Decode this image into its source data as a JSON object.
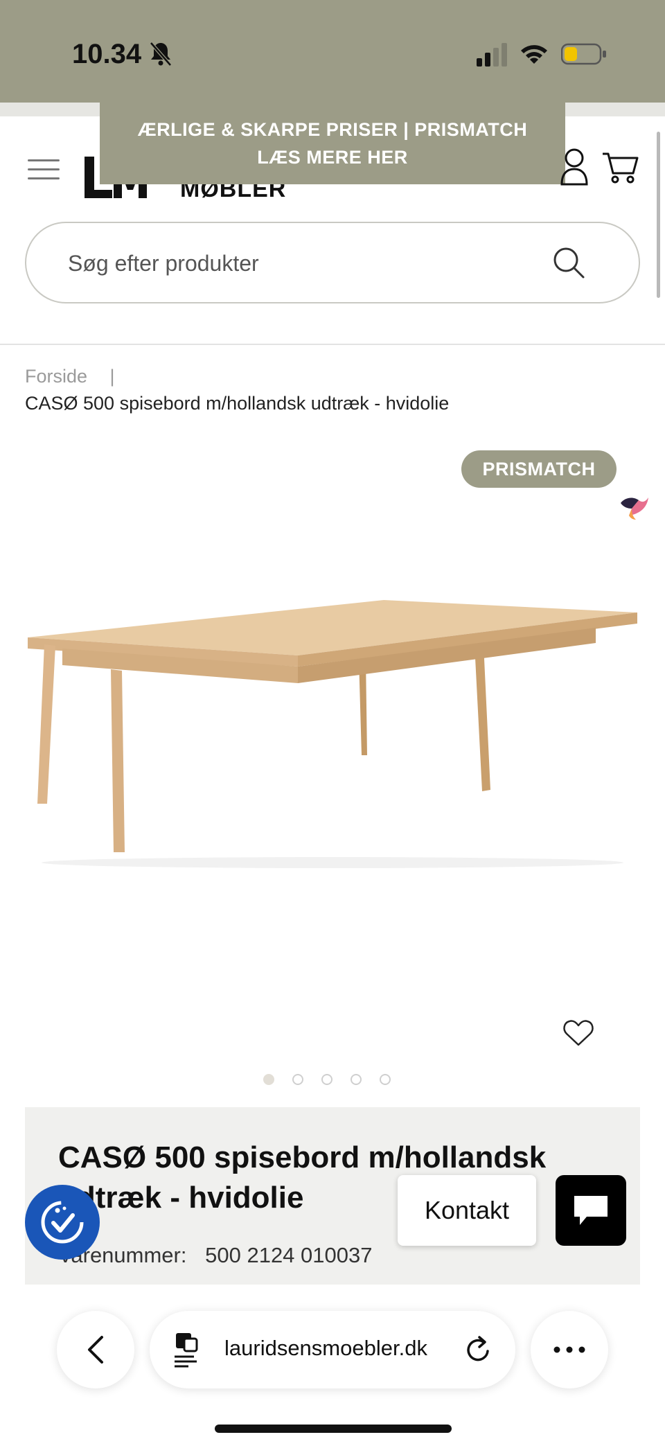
{
  "status_bar": {
    "time": "10.34"
  },
  "promo_banner": {
    "line1": "ÆRLIGE & SKARPE PRISER | PRISMATCH",
    "line2": "LÆS MERE HER"
  },
  "logo": {
    "text": "MØBLER"
  },
  "search": {
    "placeholder": "Søg efter produkter"
  },
  "breadcrumb": {
    "home": "Forside",
    "separator": "|",
    "current": "CASØ 500 spisebord m/hollandsk udtræk - hvidolie"
  },
  "product": {
    "badge": "PRISMATCH",
    "title": "CASØ 500 spisebord m/hollandsk udtræk - hvidolie",
    "sku_label": "Varenummer:",
    "sku_value": "500 2124 010037",
    "carousel_count": 5,
    "carousel_active": 0
  },
  "widgets": {
    "contact_label": "Kontakt"
  },
  "browser": {
    "url": "lauridsensmoebler.dk"
  },
  "colors": {
    "brand": "#9c9c87",
    "accessibility": "#1a56b8",
    "chat": "#000000"
  },
  "icons": [
    "bell-slash-icon",
    "signal-icon",
    "wifi-icon",
    "battery-icon",
    "hamburger-menu-icon",
    "user-icon",
    "cart-icon",
    "search-icon",
    "heart-icon",
    "accessibility-icon",
    "chat-icon",
    "back-chevron-icon",
    "page-icon",
    "reload-icon",
    "more-icon"
  ]
}
